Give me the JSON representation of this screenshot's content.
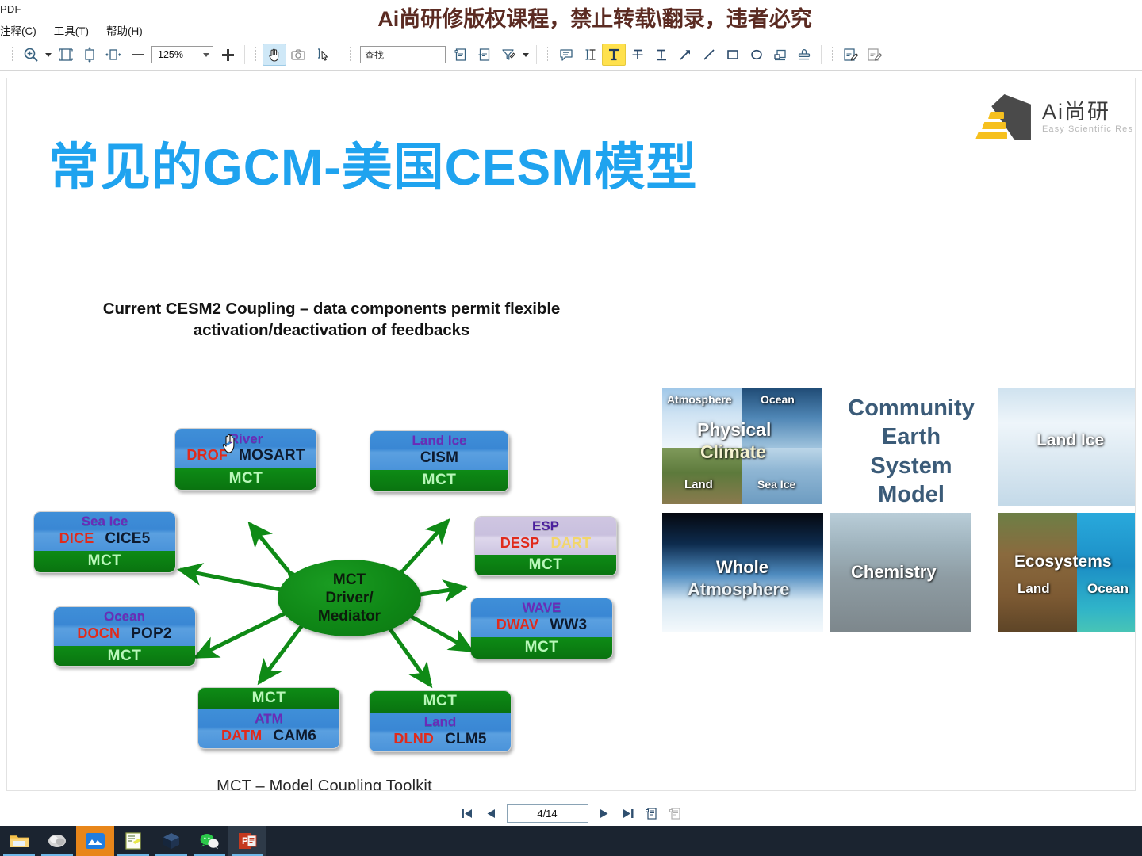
{
  "window": {
    "app_title": "PDF",
    "banner_text": "Ai尚研修版权课程，禁止转载\\翻录，违者必究",
    "menu": [
      {
        "label": "注释(C)",
        "name": "menu-annotate"
      },
      {
        "label": "工具(T)",
        "name": "menu-tools"
      },
      {
        "label": "帮助(H)",
        "name": "menu-help"
      }
    ]
  },
  "toolbar": {
    "zoom_value": "125%",
    "find_placeholder": "查找",
    "buttons": [
      {
        "name": "zoom-tool-icon",
        "title": "Zoom"
      },
      {
        "name": "fit-page-icon",
        "title": "Fit page"
      },
      {
        "name": "fit-height-icon",
        "title": "Fit height"
      },
      {
        "name": "fit-width-icon",
        "title": "Fit width"
      },
      {
        "name": "zoom-out-icon",
        "title": "Zoom out"
      },
      {
        "name": "zoom-in-icon",
        "title": "Zoom in"
      },
      {
        "name": "hand-tool-icon",
        "title": "Hand tool"
      },
      {
        "name": "snapshot-icon",
        "title": "Snapshot"
      },
      {
        "name": "select-text-icon",
        "title": "Select text"
      },
      {
        "name": "copy-page-icon",
        "title": "Copy page"
      },
      {
        "name": "extract-page-icon",
        "title": "Extract page"
      },
      {
        "name": "highlight-filter-icon",
        "title": "Filter"
      },
      {
        "name": "note-comment-icon",
        "title": "Note"
      },
      {
        "name": "text-cursor-icon",
        "title": "Text edit"
      },
      {
        "name": "highlight-text-icon",
        "title": "Highlight"
      },
      {
        "name": "strikethrough-icon",
        "title": "Strikethrough"
      },
      {
        "name": "underline-icon",
        "title": "Underline"
      },
      {
        "name": "arrow-draw-icon",
        "title": "Arrow"
      },
      {
        "name": "line-draw-icon",
        "title": "Line"
      },
      {
        "name": "rectangle-draw-icon",
        "title": "Rectangle"
      },
      {
        "name": "ellipse-draw-icon",
        "title": "Ellipse"
      },
      {
        "name": "stamp-area-icon",
        "title": "Stamp area"
      },
      {
        "name": "stamp-icon",
        "title": "Stamp"
      },
      {
        "name": "sign-icon",
        "title": "Sign"
      },
      {
        "name": "sign-alt-icon",
        "title": "Sign options"
      }
    ]
  },
  "brand": {
    "name": "Ai尚研",
    "subtitle": "Easy Scientific Res"
  },
  "slide": {
    "title": "常见的GCM-美国CESM模型",
    "diagram_heading": "Current CESM2 Coupling – data components permit flexible activation/deactivation of feedbacks",
    "diagram_caption": "MCT – Model Coupling Toolkit",
    "hub": {
      "line1": "MCT",
      "line2": "Driver/",
      "line3": "Mediator"
    },
    "mct_label": "MCT",
    "nodes": [
      {
        "id": "river",
        "title": "River",
        "data_model": "DROF",
        "active_model": "MOSART",
        "mct_on_top": false,
        "style": "blue"
      },
      {
        "id": "landice",
        "title": "Land Ice",
        "data_model": "",
        "active_model": "CISM",
        "mct_on_top": false,
        "style": "blue"
      },
      {
        "id": "seaice",
        "title": "Sea Ice",
        "data_model": "DICE",
        "active_model": "CICE5",
        "mct_on_top": false,
        "style": "blue"
      },
      {
        "id": "ocean",
        "title": "Ocean",
        "data_model": "DOCN",
        "active_model": "POP2",
        "mct_on_top": false,
        "style": "blue"
      },
      {
        "id": "esp",
        "title": "ESP",
        "data_model": "DESP",
        "active_model": "DART",
        "mct_on_top": false,
        "style": "lavender"
      },
      {
        "id": "wave",
        "title": "WAVE",
        "data_model": "DWAV",
        "active_model": "WW3",
        "mct_on_top": false,
        "style": "blue"
      },
      {
        "id": "atm",
        "title": "ATM",
        "data_model": "DATM",
        "active_model": "CAM6",
        "mct_on_top": true,
        "style": "blue"
      },
      {
        "id": "land",
        "title": "Land",
        "data_model": "DLND",
        "active_model": "CLM5",
        "mct_on_top": true,
        "style": "blue"
      }
    ],
    "collage": {
      "cesm_label": "Community\nEarth\nSystem\nModel",
      "cesm_label_lines": [
        "Community",
        "Earth",
        "System",
        "Model"
      ],
      "tiles": [
        {
          "id": "physical-climate",
          "main": "Physical Climate",
          "sub": [
            "Atmosphere",
            "Ocean",
            "Land",
            "Sea Ice"
          ]
        },
        {
          "id": "whole-atmosphere",
          "main": "Whole Atmosphere",
          "sub": []
        },
        {
          "id": "chemistry",
          "main": "Chemistry",
          "sub": []
        },
        {
          "id": "land-ice",
          "main": "Land Ice",
          "sub": []
        },
        {
          "id": "ecosystems",
          "main": "Ecosystems",
          "sub": [
            "Land",
            "Ocean"
          ]
        }
      ]
    }
  },
  "collage_text": {
    "atmosphere": "Atmosphere",
    "ocean": "Ocean",
    "land": "Land",
    "seaice": "Sea Ice",
    "physical": "Physical",
    "climate": "Climate",
    "cesm_l1": "Community",
    "cesm_l2": "Earth",
    "cesm_l3": "System",
    "cesm_l4": "Model",
    "whole": "Whole",
    "atmos2": "Atmosphere",
    "chemistry": "Chemistry",
    "landice": "Land Ice",
    "ecosystems": "Ecosystems",
    "eco_land": "Land",
    "eco_ocean": "Ocean"
  },
  "navigation": {
    "page_indicator": "4/14",
    "first_label": "first-page",
    "prev_label": "previous-page",
    "next_label": "next-page",
    "last_label": "last-page"
  },
  "taskbar": {
    "items": [
      {
        "name": "file-explorer-icon",
        "label": "File Explorer"
      },
      {
        "name": "app-gray-icon",
        "label": "App"
      },
      {
        "name": "mountain-app-icon",
        "label": "Mountain App"
      },
      {
        "name": "document-app-icon",
        "label": "Document App"
      },
      {
        "name": "virtualbox-icon",
        "label": "VirtualBox"
      },
      {
        "name": "wechat-icon",
        "label": "WeChat"
      },
      {
        "name": "powerpoint-icon",
        "label": "PowerPoint"
      }
    ]
  },
  "colors": {
    "title_blue": "#1fa3ef",
    "node_blue": "#3a87d4",
    "node_lavender": "#cfc6e2",
    "mct_green": "#0b7e12",
    "hub_green": "#0f8716",
    "data_red": "#e02b1c",
    "active_dark": "#0d1a2e",
    "title_purple": "#6b2bb8",
    "dart_yellow": "#f2d66b",
    "taskbar_bg": "#1b2430",
    "accent_orange": "#e8861a"
  }
}
